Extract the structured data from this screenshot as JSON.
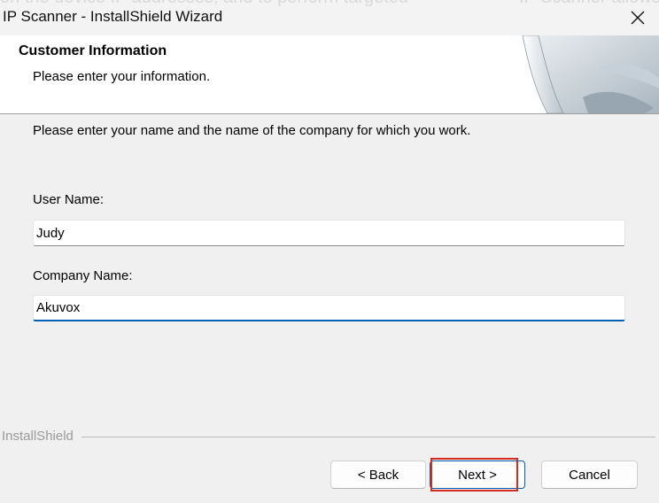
{
  "window": {
    "title": "IP Scanner - InstallShield Wizard",
    "background_text_left": "on the device IP addresses, and to perform targeted",
    "background_text_right": "IP Scanner allows"
  },
  "header": {
    "title": "Customer Information",
    "subtitle": "Please enter your information."
  },
  "main": {
    "instruction": "Please enter your name and the name of the company for which you work.",
    "user_name": {
      "label": "User Name:",
      "value": "Judy"
    },
    "company_name": {
      "label": "Company Name:",
      "value": "Akuvox"
    }
  },
  "footer": {
    "brand": "InstallShield",
    "back_label": "< Back",
    "next_label": "Next >",
    "cancel_label": "Cancel"
  },
  "colors": {
    "accent": "#005fb8",
    "highlight": "#d62c1e",
    "dialog_bg": "#f0f0f0"
  },
  "icons": [
    "close-icon",
    "installshield-banner-art"
  ]
}
